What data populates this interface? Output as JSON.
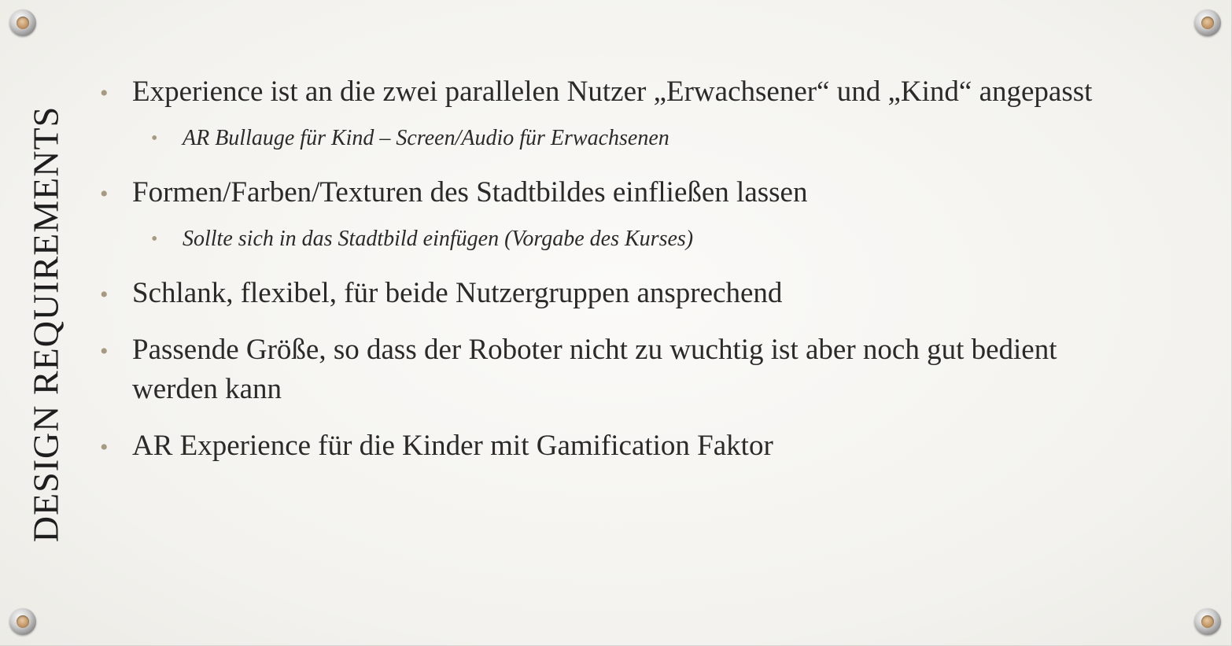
{
  "slide": {
    "title": "DESIGN REQUIREMENTS",
    "bullets": [
      {
        "text": "Experience ist an die zwei parallelen Nutzer „Erwachsener“ und „Kind“ angepasst",
        "sub": "AR Bullauge für Kind – Screen/Audio für Erwachsenen"
      },
      {
        "text": "Formen/Farben/Texturen des Stadtbildes einfließen lassen",
        "sub": "Sollte sich in das Stadtbild einfügen (Vorgabe des Kurses)"
      },
      {
        "text": "Schlank, flexibel, für beide Nutzergruppen ansprechend"
      },
      {
        "text": "Passende Größe, so dass der Roboter nicht zu wuchtig ist aber noch gut bedient werden kann"
      },
      {
        "text": "AR Experience für die Kinder mit Gamification Faktor"
      }
    ],
    "bullet_symbol": "•",
    "bullet_color": "#a89a80"
  }
}
